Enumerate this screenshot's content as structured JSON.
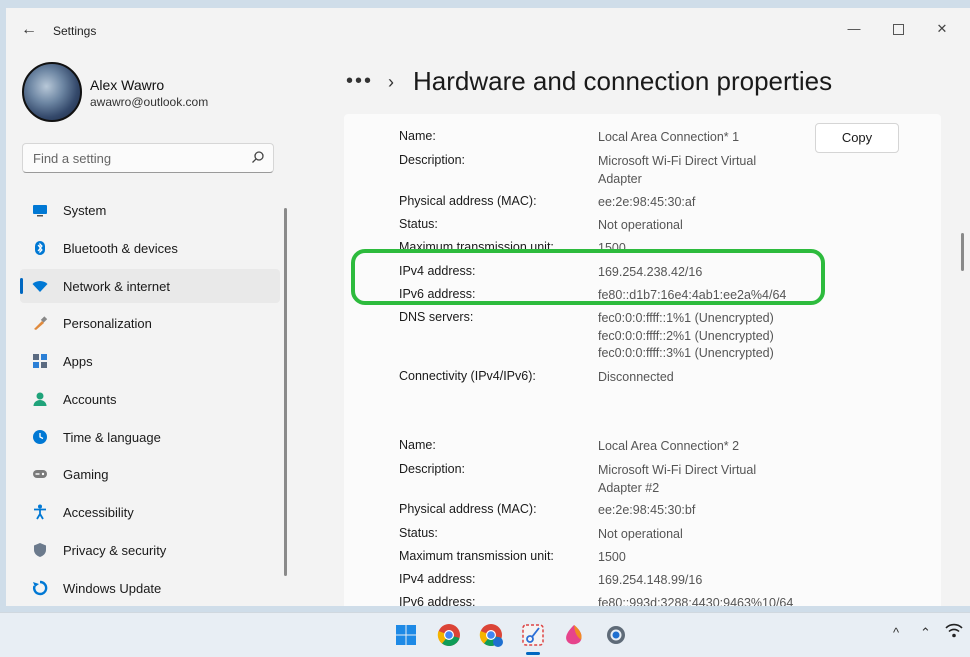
{
  "app": {
    "title": "Settings"
  },
  "window_controls": {
    "minimize": "—",
    "close": "✕"
  },
  "profile": {
    "name": "Alex Wawro",
    "email": "awawro@outlook.com"
  },
  "search": {
    "placeholder": "Find a setting"
  },
  "sidebar": {
    "items": [
      {
        "label": "System",
        "icon": "monitor-icon",
        "color": "#0078d4"
      },
      {
        "label": "Bluetooth & devices",
        "icon": "bluetooth-icon",
        "color": "#0078d4"
      },
      {
        "label": "Network & internet",
        "icon": "wifi-icon",
        "color": "#0078d4",
        "active": true
      },
      {
        "label": "Personalization",
        "icon": "brush-icon",
        "color": "#e08a3c"
      },
      {
        "label": "Apps",
        "icon": "apps-icon",
        "color": "#5a6a80"
      },
      {
        "label": "Accounts",
        "icon": "person-icon",
        "color": "#1fa37a"
      },
      {
        "label": "Time & language",
        "icon": "globe-clock-icon",
        "color": "#0078d4"
      },
      {
        "label": "Gaming",
        "icon": "gamepad-icon",
        "color": "#7a7a7a"
      },
      {
        "label": "Accessibility",
        "icon": "accessibility-icon",
        "color": "#0078d4"
      },
      {
        "label": "Privacy & security",
        "icon": "shield-icon",
        "color": "#6b7a8c"
      },
      {
        "label": "Windows Update",
        "icon": "update-icon",
        "color": "#0078d4"
      }
    ]
  },
  "breadcrumb": {
    "overflow": "•••",
    "separator": "›",
    "title": "Hardware and connection properties"
  },
  "copy_button": {
    "label": "Copy"
  },
  "properties": [
    {
      "key": "Name:",
      "value": "Local Area Connection* 1"
    },
    {
      "key": "Description:",
      "value": "Microsoft Wi-Fi Direct Virtual Adapter"
    },
    {
      "key": "Physical address (MAC):",
      "value": "ee:2e:98:45:30:af"
    },
    {
      "key": "Status:",
      "value": "Not operational"
    },
    {
      "key": "Maximum transmission unit:",
      "value": "1500"
    },
    {
      "key": "IPv4 address:",
      "value": "169.254.238.42/16"
    },
    {
      "key": "IPv6 address:",
      "value": "fe80::d1b7:16e4:4ab1:ee2a%4/64"
    },
    {
      "key": "DNS servers:",
      "value": "fec0:0:0:ffff::1%1 (Unencrypted)\nfec0:0:0:ffff::2%1 (Unencrypted)\nfec0:0:0:ffff::3%1 (Unencrypted)"
    },
    {
      "key": "Connectivity (IPv4/IPv6):",
      "value": "Disconnected"
    },
    {
      "key": "Name:",
      "value": "Local Area Connection* 2"
    },
    {
      "key": "Description:",
      "value": "Microsoft Wi-Fi Direct Virtual Adapter #2"
    },
    {
      "key": "Physical address (MAC):",
      "value": "ee:2e:98:45:30:bf"
    },
    {
      "key": "Status:",
      "value": "Not operational"
    },
    {
      "key": "Maximum transmission unit:",
      "value": "1500"
    },
    {
      "key": "IPv4 address:",
      "value": "169.254.148.99/16"
    },
    {
      "key": "IPv6 address:",
      "value": "fe80::993d:3288:4430:9463%10/64"
    }
  ],
  "highlight_color": "#2dbb3d",
  "taskbar": {
    "apps": [
      "windows-start-icon",
      "chrome-icon",
      "chrome-profile-icon",
      "snipping-tool-icon",
      "edge-icon",
      "settings-gear-icon"
    ],
    "active_app": "snipping-tool-icon",
    "tray": {
      "chevron": "^",
      "up": "⌃",
      "network": "wifi-icon"
    }
  }
}
